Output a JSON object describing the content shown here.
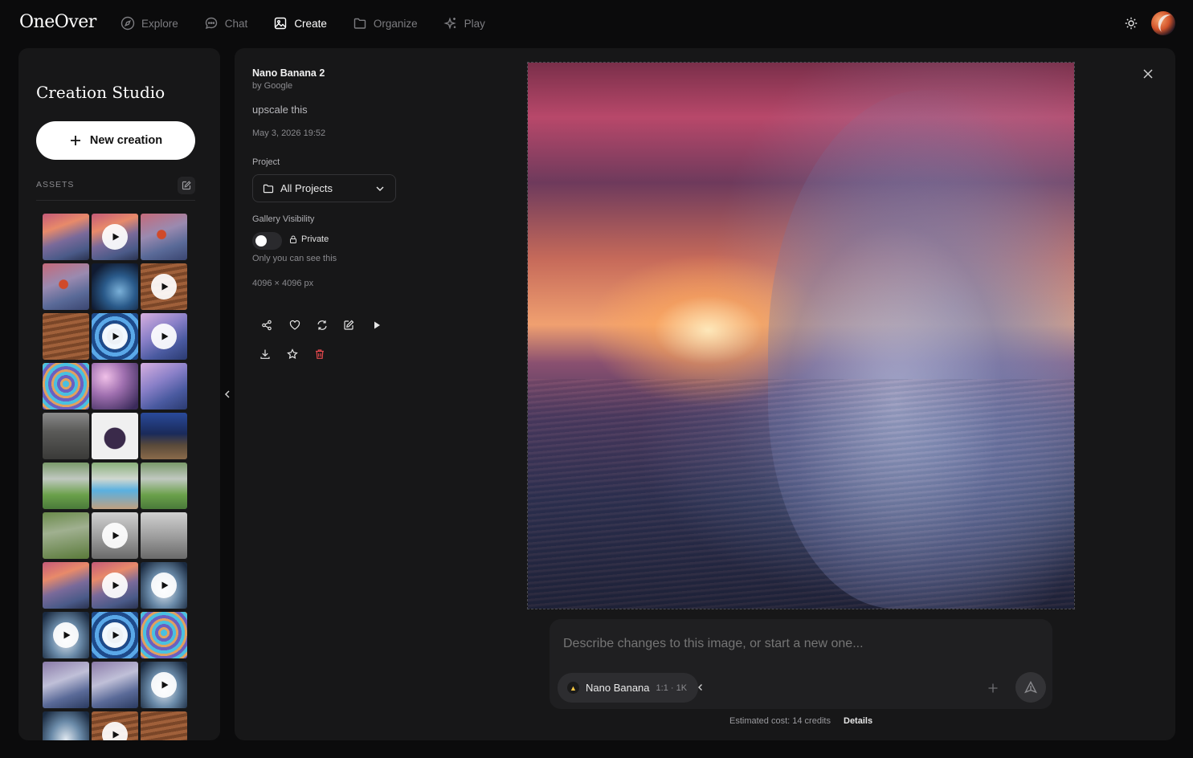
{
  "app": {
    "logo": "OneOver"
  },
  "nav": [
    {
      "label": "Explore",
      "icon": "compass-icon",
      "active": false
    },
    {
      "label": "Chat",
      "icon": "chat-bubble-icon",
      "active": false
    },
    {
      "label": "Create",
      "icon": "image-icon",
      "active": true
    },
    {
      "label": "Organize",
      "icon": "folder-icon",
      "active": false
    },
    {
      "label": "Play",
      "icon": "sparkles-icon",
      "active": false
    }
  ],
  "sidebar": {
    "title": "Creation Studio",
    "new_button": "New creation",
    "assets_label": "ASSETS",
    "thumbnails": [
      {
        "kind": "wave-sunset",
        "video": false
      },
      {
        "kind": "wave-sunset",
        "video": true
      },
      {
        "kind": "surfer",
        "video": false
      },
      {
        "kind": "surfer",
        "video": false
      },
      {
        "kind": "wave-deep",
        "video": false
      },
      {
        "kind": "sand",
        "video": true
      },
      {
        "kind": "sand",
        "video": false
      },
      {
        "kind": "ripple-blue",
        "video": true
      },
      {
        "kind": "wave-purple",
        "video": true
      },
      {
        "kind": "ripple-iridescent",
        "video": false
      },
      {
        "kind": "sparkle-purple",
        "video": false
      },
      {
        "kind": "wave-purple",
        "video": false
      },
      {
        "kind": "person",
        "video": false
      },
      {
        "kind": "graphic",
        "video": false
      },
      {
        "kind": "backyard-night",
        "video": false
      },
      {
        "kind": "garden",
        "video": false
      },
      {
        "kind": "pool",
        "video": false
      },
      {
        "kind": "garden",
        "video": false
      },
      {
        "kind": "garden-wild",
        "video": false
      },
      {
        "kind": "street",
        "video": true
      },
      {
        "kind": "street",
        "video": false
      },
      {
        "kind": "wave-sunset",
        "video": false
      },
      {
        "kind": "wave-sunset",
        "video": true
      },
      {
        "kind": "wave-foam",
        "video": true
      },
      {
        "kind": "wave-foam",
        "video": true
      },
      {
        "kind": "ripple-blue",
        "video": true
      },
      {
        "kind": "ripple-iridescent",
        "video": false
      },
      {
        "kind": "wave-foam-purple",
        "video": false
      },
      {
        "kind": "wave-foam-purple",
        "video": false
      },
      {
        "kind": "wave-foam",
        "video": true
      },
      {
        "kind": "wave-foam",
        "video": false
      },
      {
        "kind": "sand",
        "video": true
      },
      {
        "kind": "sand",
        "video": false
      }
    ]
  },
  "detail": {
    "model_name": "Nano Banana 2",
    "model_by": "by Google",
    "prompt": "upscale this",
    "date": "May 3, 2026 19:52",
    "project_label": "Project",
    "project_value": "All Projects",
    "visibility_label": "Gallery Visibility",
    "visibility_value": "Private",
    "visibility_public": false,
    "visibility_note": "Only you can see this",
    "dimensions": "4096 × 4096 px",
    "actions": [
      "share-icon",
      "heart-icon",
      "refresh-icon",
      "edit-icon",
      "play-icon",
      "download-icon",
      "star-icon",
      "trash-icon"
    ]
  },
  "composer": {
    "placeholder": "Describe changes to this image, or start a new one...",
    "model": "Nano Banana",
    "model_meta": "1:1 · 1K",
    "cost": "Estimated cost: 14 credits",
    "details": "Details"
  },
  "colors": {
    "background": "#0b0b0c",
    "panel": "#171718",
    "danger": "#e5484d",
    "accent_white": "#ffffff"
  }
}
